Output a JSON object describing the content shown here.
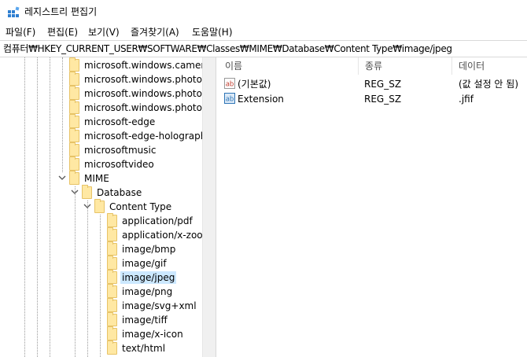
{
  "window": {
    "title": "레지스트리 편집기",
    "icon": "regedit-icon"
  },
  "menu": [
    {
      "label": "파일(F)"
    },
    {
      "label": "편집(E)"
    },
    {
      "label": "보기(V)"
    },
    {
      "label": "즐겨찾기(A)"
    },
    {
      "label": "도움말(H)"
    }
  ],
  "address": {
    "path": "컴퓨터₩HKEY_CURRENT_USER₩SOFTWARE₩Classes₩MIME₩Database₩Content Type₩image/jpeg"
  },
  "tree": {
    "items": [
      {
        "label": "microsoft.windows.camera.p",
        "expanded": false
      },
      {
        "label": "microsoft.windows.photos.c",
        "expanded": false
      },
      {
        "label": "microsoft.windows.photos.p",
        "expanded": false
      },
      {
        "label": "microsoft.windows.photos.v",
        "expanded": false
      },
      {
        "label": "microsoft-edge",
        "expanded": false
      },
      {
        "label": "microsoft-edge-holographic",
        "expanded": false
      },
      {
        "label": "microsoftmusic",
        "expanded": false
      },
      {
        "label": "microsoftvideo",
        "expanded": false
      },
      {
        "label": "MIME",
        "expanded": true
      },
      {
        "label": "Database",
        "expanded": true
      },
      {
        "label": "Content Type",
        "expanded": true
      },
      {
        "label": "application/pdf",
        "expanded": false
      },
      {
        "label": "application/x-zoom",
        "expanded": false
      },
      {
        "label": "image/bmp",
        "expanded": false
      },
      {
        "label": "image/gif",
        "expanded": false
      },
      {
        "label": "image/jpeg",
        "expanded": false,
        "selected": true
      },
      {
        "label": "image/png",
        "expanded": false
      },
      {
        "label": "image/svg+xml",
        "expanded": false
      },
      {
        "label": "image/tiff",
        "expanded": false
      },
      {
        "label": "image/x-icon",
        "expanded": false
      },
      {
        "label": "text/html",
        "expanded": false
      }
    ]
  },
  "values": {
    "columns": [
      "이름",
      "종류",
      "데이터"
    ],
    "rows": [
      {
        "icon": "string-value-icon",
        "name": "(기본값)",
        "type": "REG_SZ",
        "data": "(값 설정 안 됨)"
      },
      {
        "icon": "binary-value-icon",
        "name": "Extension",
        "type": "REG_SZ",
        "data": ".jfif"
      }
    ]
  },
  "colors": {
    "selection": "#cce8ff",
    "folder": "#ffe8a3",
    "folder_border": "#e7c367",
    "icon_red": "#c0392b",
    "icon_blue": "#2e75b6"
  }
}
